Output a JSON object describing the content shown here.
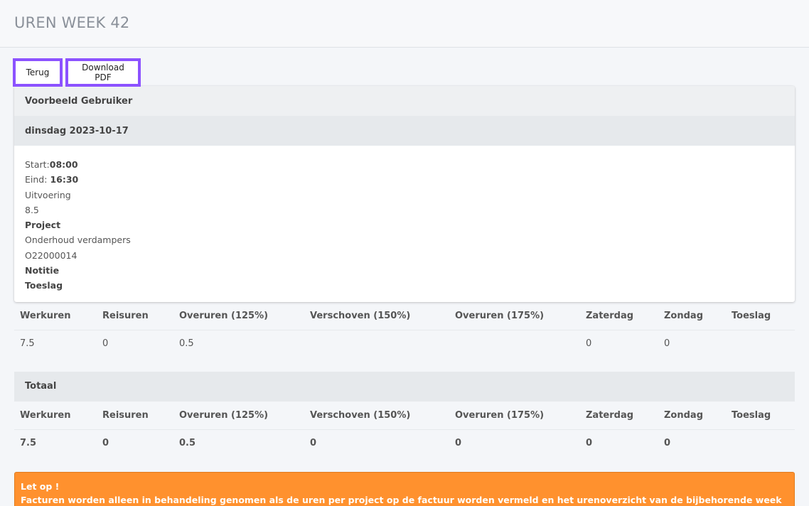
{
  "header": {
    "title": "UREN WEEK 42"
  },
  "buttons": {
    "back": "Terug",
    "pdf": "Download PDF"
  },
  "user": {
    "name": "Voorbeeld Gebruiker"
  },
  "day": {
    "label": "dinsdag 2023-10-17",
    "start_label": "Start:",
    "start_value": "08:00",
    "end_label": "Eind:",
    "end_value": "16:30",
    "type": "Uitvoering",
    "hours": "8.5",
    "project_label": "Project",
    "project_name": "Onderhoud verdampers",
    "project_code": "O22000014",
    "note_label": "Notitie",
    "allowance_label": "Toeslag"
  },
  "columns": [
    "Werkuren",
    "Reisuren",
    "Overuren (125%)",
    "Verschoven (150%)",
    "Overuren (175%)",
    "Zaterdag",
    "Zondag",
    "Toeslag"
  ],
  "day_row": [
    "7.5",
    "0",
    "0.5",
    "",
    "",
    "0",
    "0",
    ""
  ],
  "total": {
    "label": "Totaal",
    "row": [
      "7.5",
      "0",
      "0.5",
      "0",
      "0",
      "0",
      "0",
      ""
    ]
  },
  "alert": {
    "title": "Let op !",
    "text": "Facturen worden alleen in behandeling genomen als de uren per project op de factuur worden vermeld en het urenoverzicht van de bijbehorende week als bijlage is meegestuurd."
  }
}
